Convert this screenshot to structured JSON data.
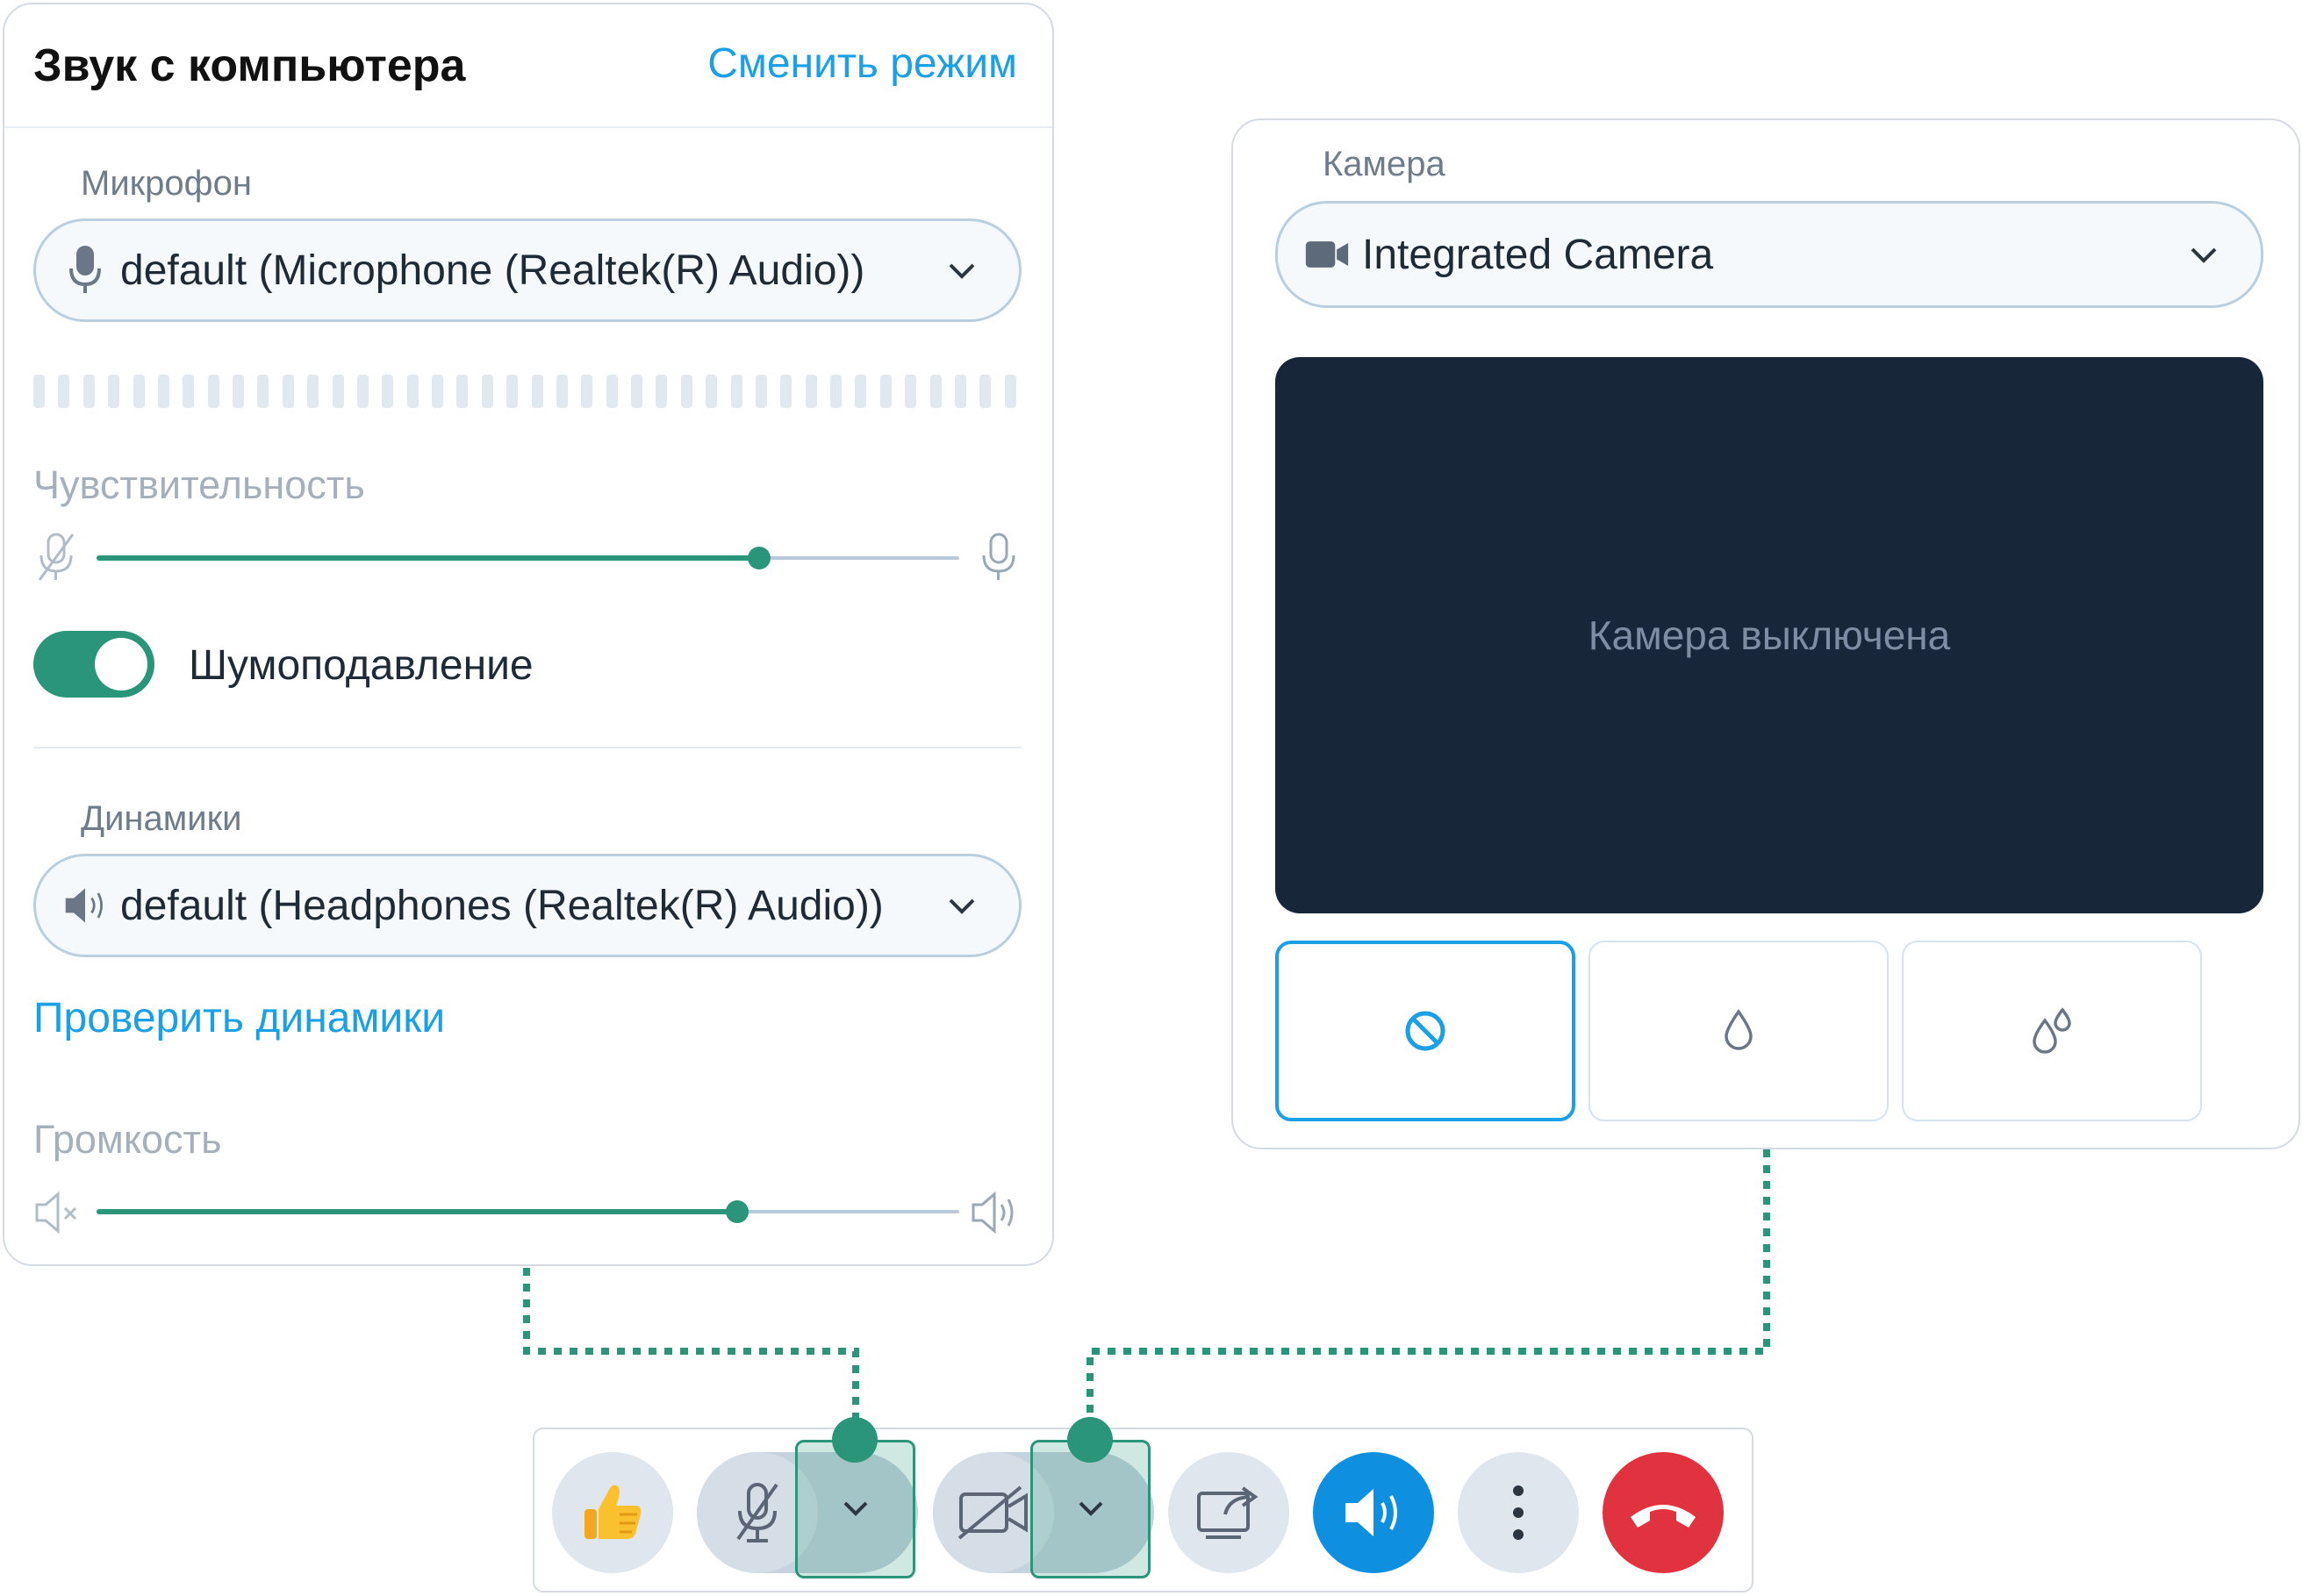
{
  "audio_panel": {
    "title": "Звук с компьютера",
    "switch_mode_link": "Сменить режим",
    "microphone_label": "Микрофон",
    "microphone_value": "default (Microphone (Realtek(R) Audio))",
    "sensitivity_label": "Чувствительность",
    "sensitivity_level": 0.72,
    "noise_suppression_label": "Шумоподавление",
    "noise_suppression_on": true,
    "speakers_label": "Динамики",
    "speakers_value": "default (Headphones (Realtek(R) Audio))",
    "test_speakers_link": "Проверить динамики",
    "volume_label": "Громкость",
    "volume_level": 0.7
  },
  "camera_panel": {
    "camera_label": "Камера",
    "camera_value": "Integrated Camera",
    "preview_text": "Камера выключена",
    "effects": [
      {
        "icon": "none-icon",
        "selected": true
      },
      {
        "icon": "blur-icon",
        "selected": false
      },
      {
        "icon": "strong-blur-icon",
        "selected": false
      }
    ]
  },
  "toolbar": {
    "buttons": [
      "thumbs-up",
      "microphone-muted",
      "audio-options",
      "camera-off",
      "video-options",
      "share-screen",
      "speaker",
      "more",
      "hang-up"
    ]
  },
  "colors": {
    "accent": "#2a9579",
    "link": "#1ba0e6",
    "speaker_button": "#0f8fe0",
    "hangup_button": "#e0333f",
    "preview_bg": "#18263a"
  }
}
